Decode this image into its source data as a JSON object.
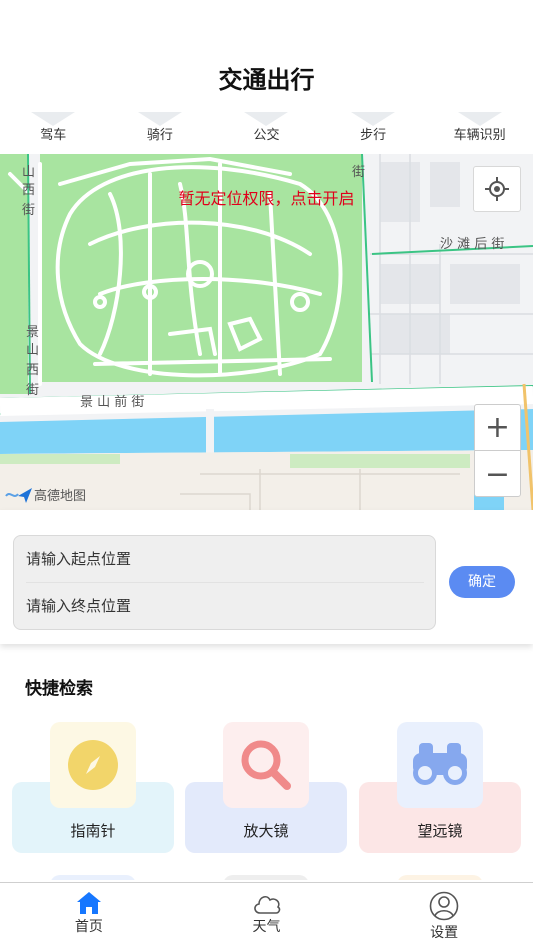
{
  "header": {
    "title": "交通出行"
  },
  "mode_tabs": [
    {
      "label": "驾车"
    },
    {
      "label": "骑行"
    },
    {
      "label": "公交"
    },
    {
      "label": "步行"
    },
    {
      "label": "车辆识别"
    }
  ],
  "map": {
    "notice": "暂无定位权限，点击开启",
    "labels": {
      "street_left_top": "山西街",
      "street_right_top": "沙滩后街",
      "street_left_mid": "景山西街",
      "street_bottom": "景山前街",
      "street_top_mid": "街"
    },
    "zoom_in": "+",
    "zoom_out": "−",
    "logo_text": "高德地图"
  },
  "route": {
    "start_placeholder": "请输入起点位置",
    "end_placeholder": "请输入终点位置",
    "confirm_label": "确定"
  },
  "quick": {
    "title": "快捷检索",
    "tools": [
      {
        "label": "指南针",
        "icon": "compass-icon",
        "card_color": "#e3f4fa",
        "icon_bg": "#fdf8e4",
        "icon_color": "#f2d56a"
      },
      {
        "label": "放大镜",
        "icon": "magnifier-icon",
        "card_color": "#e3eafb",
        "icon_bg": "#fdeeee",
        "icon_color": "#f08a8a"
      },
      {
        "label": "望远镜",
        "icon": "binoculars-icon",
        "card_color": "#fce6e6",
        "icon_bg": "#e9f0fd",
        "icon_color": "#86a8ee"
      }
    ]
  },
  "tabbar": {
    "items": [
      {
        "label": "首页",
        "icon": "home-icon"
      },
      {
        "label": "天气",
        "icon": "cloud-icon"
      },
      {
        "label": "设置",
        "icon": "user-icon"
      }
    ],
    "active_color": "#1677ff"
  }
}
